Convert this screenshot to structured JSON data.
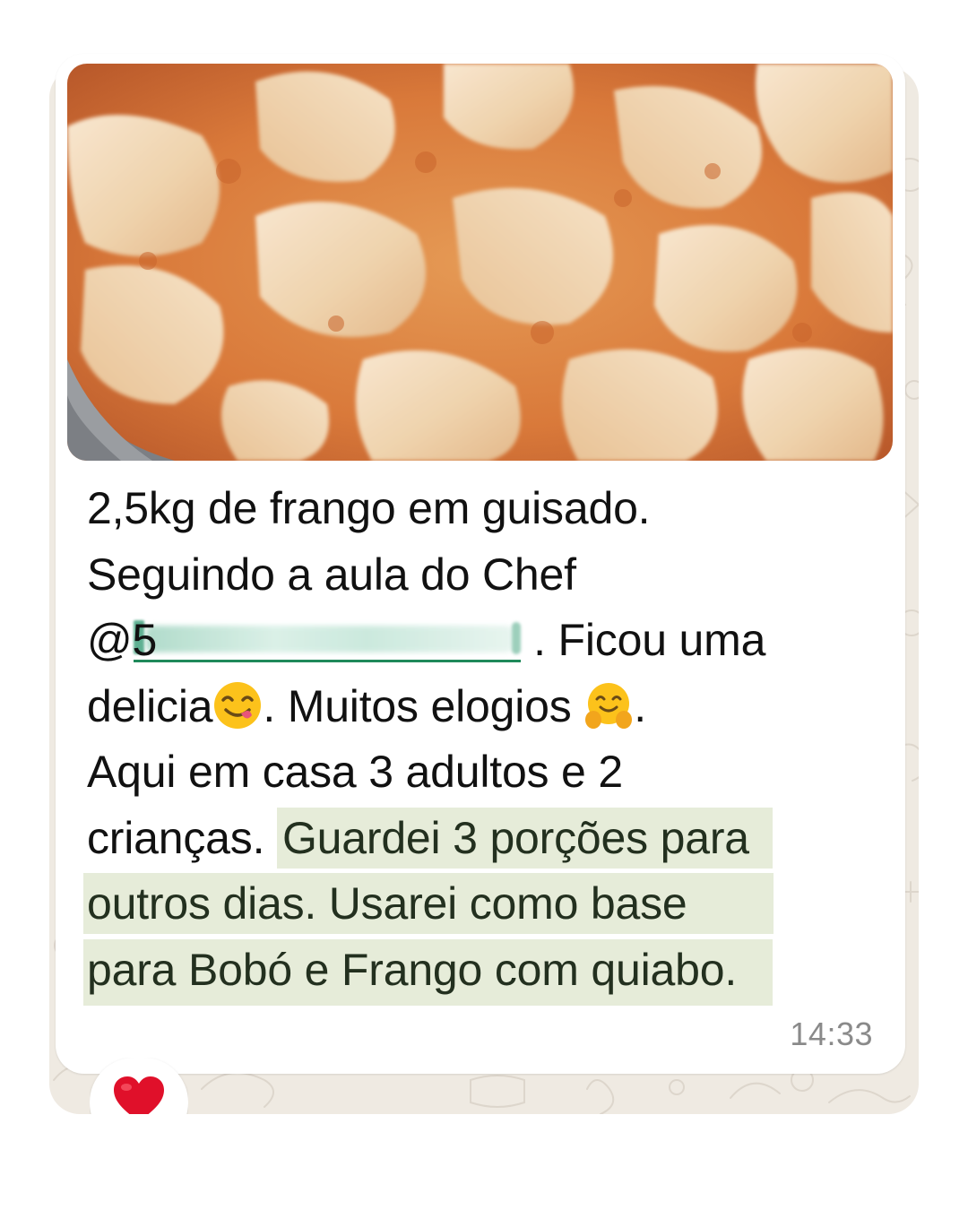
{
  "message": {
    "line1": "2,5kg de frango em guisado.",
    "line2": "Seguindo a aula do Chef",
    "mention_prefix": "@5",
    "line3_after_mention": ". Ficou uma",
    "line4_a": "delicia",
    "line4_b": ". Muitos elogios ",
    "line4_c": ".",
    "line5": "Aqui em casa 3 adultos e 2",
    "line6_a": "crianças. ",
    "line6_highlight": "Guardei 3 porções para",
    "line7_highlight": "outros dias. Usarei como base",
    "line8_highlight": "para Bobó e Frango com quiabo.",
    "time": "14:33"
  },
  "emojis": {
    "after_delicia": "face-savoring-food-icon",
    "after_elogios": "hugging-face-icon"
  },
  "reaction": {
    "emoji": "red-heart-icon"
  },
  "colors": {
    "chat_background": "#efeae2",
    "bubble": "#ffffff",
    "highlight": "#e6ecd9",
    "mention_underline": "#1f8a5b",
    "timestamp": "#8a8a8a"
  }
}
